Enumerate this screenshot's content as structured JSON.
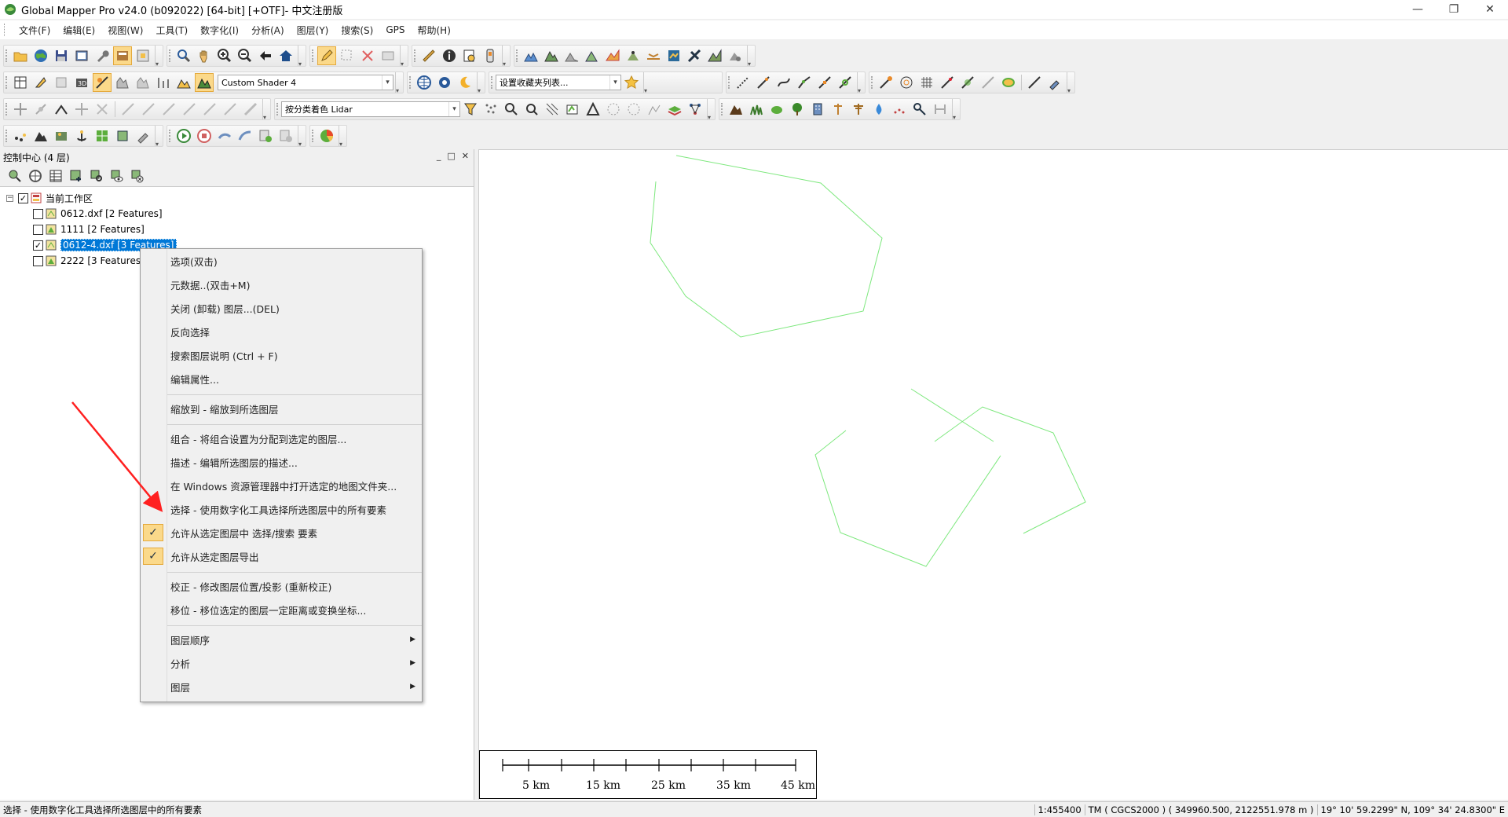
{
  "window": {
    "title": "Global Mapper Pro v24.0 (b092022) [64-bit] [+OTF]- 中文注册版",
    "minimize": "—",
    "maximize": "❐",
    "close": "✕"
  },
  "menu": [
    "文件(F)",
    "编辑(E)",
    "视图(W)",
    "工具(T)",
    "数字化(I)",
    "分析(A)",
    "图层(Y)",
    "搜索(S)",
    "GPS",
    "帮助(H)"
  ],
  "toolbar": {
    "shader_value": "Custom Shader 4",
    "bookmark_value": "设置收藏夹列表...",
    "lidar_value": "按分类着色 Lidar"
  },
  "control_center": {
    "title": "控制中心 (4 层)",
    "ctrls": [
      "_",
      "□",
      "✕"
    ],
    "root_label": "当前工作区",
    "layers": [
      {
        "label": "0612.dxf [2 Features]",
        "checked": false
      },
      {
        "label": "1111 [2 Features]",
        "checked": false
      },
      {
        "label": "0612-4.dxf [3 Features]",
        "checked": true
      },
      {
        "label": "2222 [3 Features]",
        "checked": false
      }
    ]
  },
  "context_menu": {
    "items": [
      {
        "label": "选项(双击)"
      },
      {
        "label": "元数据..(双击+M)"
      },
      {
        "label": "关闭 (卸载) 图层...(DEL)"
      },
      {
        "label": "反向选择"
      },
      {
        "label": "搜索图层说明 (Ctrl + F)"
      },
      {
        "label": "编辑属性..."
      },
      {
        "label": "缩放到 - 缩放到所选图层"
      },
      {
        "label": "组合 - 将组合设置为分配到选定的图层..."
      },
      {
        "label": "描述 - 编辑所选图层的描述..."
      },
      {
        "label": "在 Windows 资源管理器中打开选定的地图文件夹..."
      },
      {
        "label": "选择 - 使用数字化工具选择所选图层中的所有要素"
      },
      {
        "label": "允许从选定图层中 选择/搜索 要素"
      },
      {
        "label": "允许从选定图层导出"
      },
      {
        "label": "校正 - 修改图层位置/投影 (重新校正)"
      },
      {
        "label": "移位 - 移位选定的图层一定距离或变换坐标..."
      },
      {
        "label": "图层顺序"
      },
      {
        "label": "分析"
      },
      {
        "label": "图层"
      }
    ]
  },
  "scale_bar": {
    "labels": [
      "5 km",
      "15 km",
      "25 km",
      "35 km",
      "45 km"
    ]
  },
  "status": {
    "left": "选择 - 使用数字化工具选择所选图层中的所有要素",
    "scale": "1:455400",
    "projection": "TM ( CGCS2000 ) ( 349960.500, 2122551.978 m )",
    "coords": "19° 10' 59.2299\" N, 109° 34' 24.8300\" E"
  },
  "colors": {
    "feature_line": "#7ee87e",
    "selection": "#0078d7",
    "menu_check": "#fbd98a",
    "arrow": "#ff2020"
  }
}
